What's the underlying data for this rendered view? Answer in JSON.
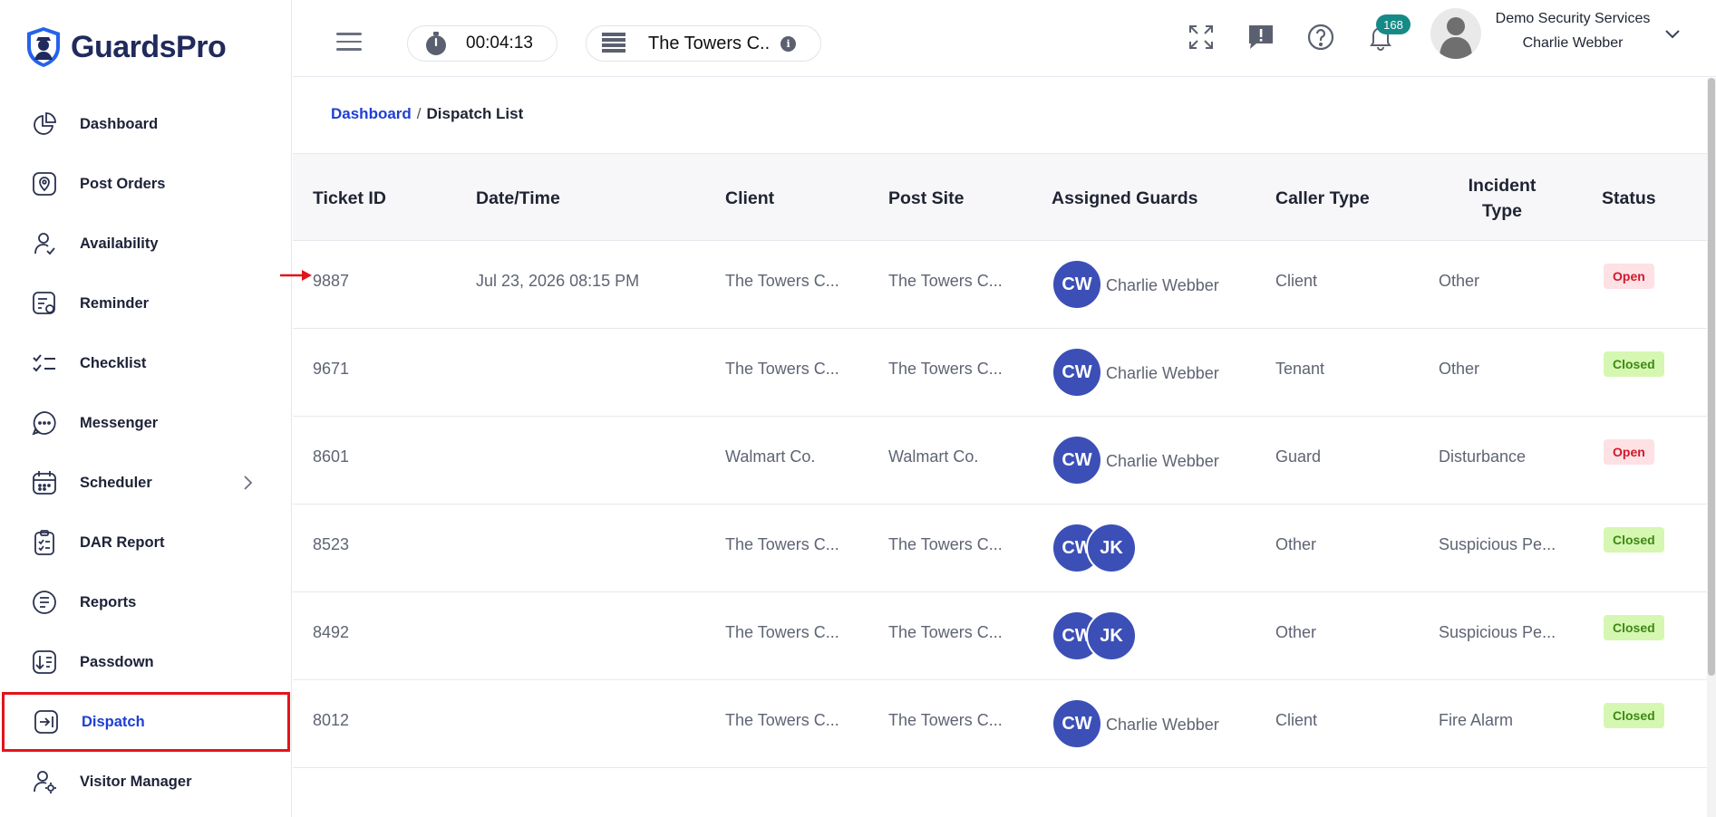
{
  "app": {
    "brand": "GuardsPro"
  },
  "sidebar": {
    "items": [
      {
        "label": "Dashboard",
        "icon": "pie-chart-icon"
      },
      {
        "label": "Post Orders",
        "icon": "location-pin-icon"
      },
      {
        "label": "Availability",
        "icon": "user-check-icon"
      },
      {
        "label": "Reminder",
        "icon": "reminder-list-icon"
      },
      {
        "label": "Checklist",
        "icon": "checklist-icon"
      },
      {
        "label": "Messenger",
        "icon": "chat-bubble-icon"
      },
      {
        "label": "Scheduler",
        "icon": "calendar-icon",
        "has_children": true
      },
      {
        "label": "DAR Report",
        "icon": "clipboard-check-icon"
      },
      {
        "label": "Reports",
        "icon": "report-lines-icon"
      },
      {
        "label": "Passdown",
        "icon": "passdown-sort-icon"
      },
      {
        "label": "Dispatch",
        "icon": "dispatch-arrow-icon",
        "active": true
      },
      {
        "label": "Visitor Manager",
        "icon": "user-gear-icon"
      }
    ]
  },
  "topbar": {
    "timer": "00:04:13",
    "site": "The Towers C..",
    "notification_count": "168",
    "company": "Demo Security Services",
    "user": "Charlie Webber"
  },
  "breadcrumb": {
    "parent": "Dashboard",
    "separator": "/",
    "current": "Dispatch List"
  },
  "table": {
    "headers": {
      "ticket_id": "Ticket ID",
      "datetime": "Date/Time",
      "client": "Client",
      "post_site": "Post Site",
      "assigned_guards": "Assigned Guards",
      "caller_type": "Caller Type",
      "incident_type_1": "Incident",
      "incident_type_2": "Type",
      "status": "Status"
    },
    "rows": [
      {
        "ticket_id": "9887",
        "datetime": "Jul 23, 2026 08:15 PM",
        "client": "The Towers C...",
        "post_site": "The Towers C...",
        "guards": [
          "CW"
        ],
        "guard_name": "Charlie Webber",
        "caller_type": "Client",
        "incident_type": "Other",
        "status": "Open"
      },
      {
        "ticket_id": "9671",
        "datetime": "",
        "client": "The Towers C...",
        "post_site": "The Towers C...",
        "guards": [
          "CW"
        ],
        "guard_name": "Charlie Webber",
        "caller_type": "Tenant",
        "incident_type": "Other",
        "status": "Closed"
      },
      {
        "ticket_id": "8601",
        "datetime": "",
        "client": "Walmart Co.",
        "post_site": "Walmart Co.",
        "guards": [
          "CW"
        ],
        "guard_name": "Charlie Webber",
        "caller_type": "Guard",
        "incident_type": "Disturbance",
        "status": "Open"
      },
      {
        "ticket_id": "8523",
        "datetime": "",
        "client": "The Towers C...",
        "post_site": "The Towers C...",
        "guards": [
          "CW",
          "JK"
        ],
        "guard_name": "",
        "caller_type": "Other",
        "incident_type": "Suspicious Pe...",
        "status": "Closed"
      },
      {
        "ticket_id": "8492",
        "datetime": "",
        "client": "The Towers C...",
        "post_site": "The Towers C...",
        "guards": [
          "CW",
          "JK"
        ],
        "guard_name": "",
        "caller_type": "Other",
        "incident_type": "Suspicious Pe...",
        "status": "Closed"
      },
      {
        "ticket_id": "8012",
        "datetime": "",
        "client": "The Towers C...",
        "post_site": "The Towers C...",
        "guards": [
          "CW"
        ],
        "guard_name": "Charlie Webber",
        "caller_type": "Client",
        "incident_type": "Fire Alarm",
        "status": "Closed"
      }
    ]
  },
  "colors": {
    "accent": "#1e3fd4",
    "avatar_bg": "#3c4fb7",
    "open_bg": "#fde1e5",
    "open_fg": "#d0192b",
    "closed_bg": "#d6f7b2",
    "closed_fg": "#3c8a12",
    "highlight": "#e3141b",
    "badge": "#168a86"
  }
}
